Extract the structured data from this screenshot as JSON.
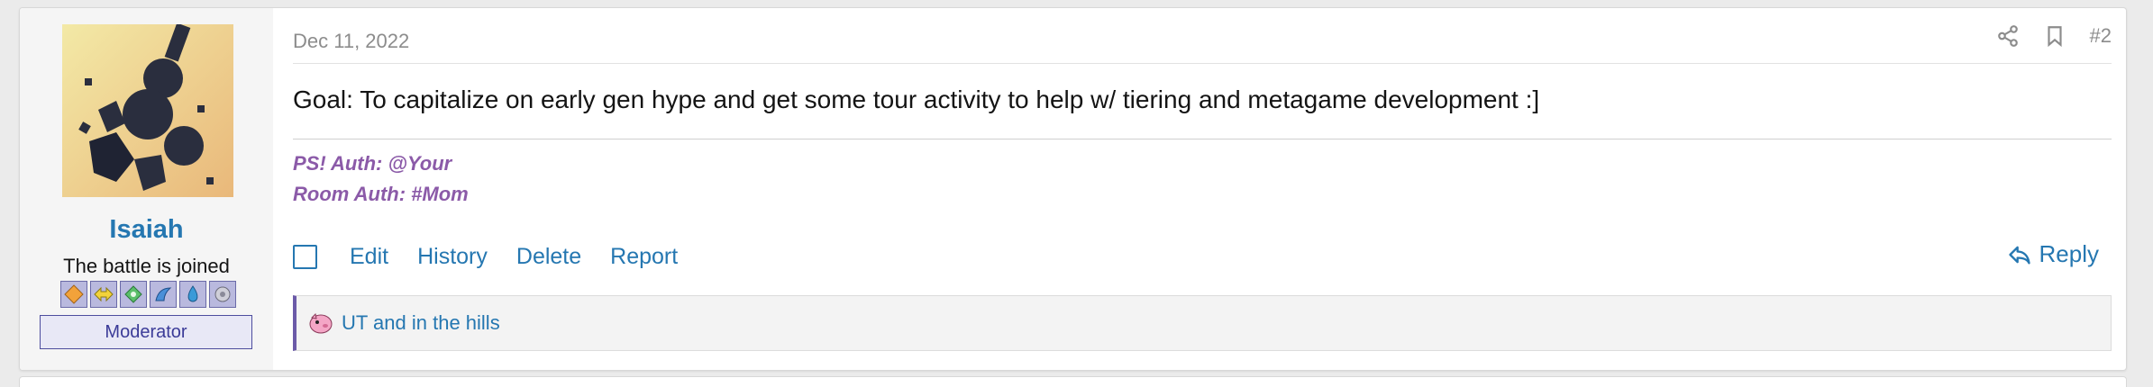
{
  "post": {
    "date": "Dec 11, 2022",
    "post_number": "#2",
    "message": "Goal: To capitalize on early gen hype and get some tour activity to help w/ tiering and metagame development :]",
    "signature": {
      "line1": "PS! Auth: @Your",
      "line2": "Room Auth: #Mom"
    },
    "actions": {
      "edit": "Edit",
      "history": "History",
      "delete": "Delete",
      "report": "Report",
      "reply": "Reply"
    },
    "location": "UT and in the hills"
  },
  "user": {
    "name": "Isaiah",
    "title": "The battle is joined",
    "role": "Moderator",
    "badges": [
      "orange-diamond-badge",
      "yellow-arrow-badge",
      "green-leaf-badge",
      "blue-fin-badge",
      "water-drop-badge",
      "silver-gear-badge"
    ]
  },
  "icons": {
    "share": "share-icon",
    "bookmark": "bookmark-icon",
    "reply": "reply-arrow-icon",
    "location": "pink-creature-icon"
  },
  "colors": {
    "link": "#2577b1",
    "signature": "#8b5aa8",
    "role_border": "#4d4d9e",
    "location_accent": "#6b5aa8"
  }
}
